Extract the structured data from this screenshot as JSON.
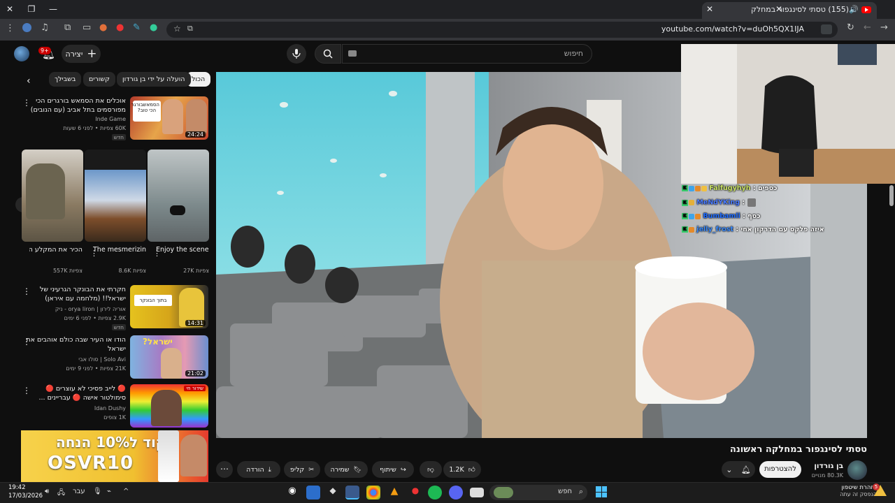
{
  "browser": {
    "tab_title": "(155) טסתי לסינגפור במחלק",
    "tab_speaker": "🔊",
    "tab_close": "✕",
    "new_tab": "+",
    "url": "youtube.com/watch?v=duOh5QX1IJA",
    "window_buttons": [
      "—",
      "❐",
      "✕"
    ]
  },
  "header": {
    "notifications_badge": "9+",
    "create_label": "יצירה",
    "search_placeholder": "חיפוש"
  },
  "chips": [
    {
      "label": "הכול",
      "active": true
    },
    {
      "label": "הועלה על ידי בן גורדון",
      "active": false
    },
    {
      "label": "קשורים",
      "active": false
    },
    {
      "label": "בשבילך",
      "active": false
    }
  ],
  "sidebar_videos": [
    {
      "title": "אוכלים את הסמאש בורגרים הכי מפורסמים בתל אביב (עם הנובים)",
      "channel": "Inde Game",
      "views_time": "60K צפיות • לפני 6 שעות",
      "badge": "חדש",
      "duration": "24:24",
      "thumb_text": "הסמאשבורגר הכי טוב?"
    },
    {
      "title": "חקרתי את הבונקר הגרעיני של ישראל!! (מלחמה עם איראן)",
      "channel": "אוריה לירון | orya liron - ניק",
      "views_time": "2.9K צפיות • לפני 6 ימים",
      "badge": "חדש",
      "duration": "14:31",
      "thumb_text": "בתוך הבונקר"
    },
    {
      "title": "הודו או העיר שבה כולם אוהבים את ישראל",
      "channel": "Solo Avi | סולו אבי",
      "views_time": "21K צפיות • לפני 9 ימים",
      "badge": "",
      "duration": "21:02",
      "thumb_text": "ישראל?"
    },
    {
      "title": "🔴 לייב פסיכי לא עוצרים 🔴 סימולטור אישה 🔴 עבריינים ...",
      "channel": "Idan Dushy",
      "views_time": "1K צופים",
      "badge": "",
      "duration": "",
      "thumb_text": "שידור חי"
    }
  ],
  "shorts": [
    {
      "title": "Enjoy the scenery.",
      "views": "27K צפיות"
    },
    {
      "title": "The mesmerizing...",
      "views": "8.6K צפיות"
    },
    {
      "title": "הכיר את המקלע החד...",
      "views": "557K צפיות"
    }
  ],
  "ad": {
    "line1": "קוד ל10% הנחה",
    "line2": "OSVR10"
  },
  "chat": [
    {
      "user": "Falfugyhyh",
      "message": "כספים",
      "color": "#c9e265"
    },
    {
      "user": "MeNdYKing",
      "message": "",
      "color": "#4a7bff"
    },
    {
      "user": "Bumbamli",
      "message": "כסף",
      "color": "#1e6cff"
    },
    {
      "user": "jelly_frost",
      "message": "איזה פלקס עם הדרקון אחי",
      "color": "#3a8bff"
    }
  ],
  "video": {
    "title": "טסתי לסינגפור במחלקה ראשונה",
    "channel_name": "בן גורדון",
    "subscribers": "80.3K מנויים",
    "join_label": "להצטרפות",
    "likes": "1.2K",
    "share_label": "שיתוף",
    "save_label": "שמירה",
    "clip_label": "קליפ",
    "download_label": "הורדה"
  },
  "taskbar": {
    "time": "19:42",
    "date": "17/03/2026",
    "lang": "עבר",
    "search_label": "חפש",
    "notif_title": "אזהרת שיטפון",
    "notif_sub": "הנפסק זה עתה",
    "notif_count": "5"
  },
  "colors": {
    "bg": "#0f0f0f",
    "chip_active": "#f1f1f1",
    "chip": "#272727",
    "badge_red": "#cc0000"
  }
}
